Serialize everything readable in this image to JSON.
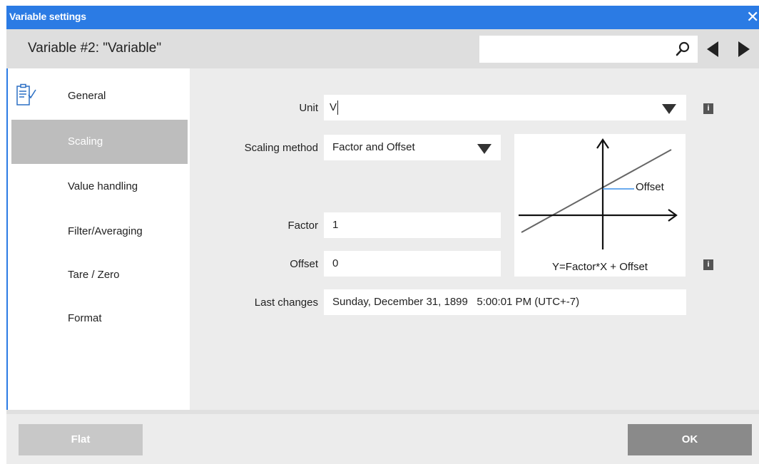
{
  "window": {
    "title": "Variable settings",
    "close": "✕"
  },
  "header": {
    "variable_title": "Variable #2: \"Variable\"",
    "search": {
      "value": "",
      "placeholder": ""
    }
  },
  "sidebar": {
    "items": [
      {
        "label": "General",
        "active": false,
        "icon": "clipboard-check-icon"
      },
      {
        "label": "Scaling",
        "active": true
      },
      {
        "label": "Value handling",
        "active": false
      },
      {
        "label": "Filter/Averaging",
        "active": false
      },
      {
        "label": "Tare / Zero",
        "active": false
      },
      {
        "label": "Format",
        "active": false
      }
    ]
  },
  "form": {
    "unit": {
      "label": "Unit",
      "value": "V"
    },
    "scaling_method": {
      "label": "Scaling method",
      "value": "Factor and Offset"
    },
    "factor": {
      "label": "Factor",
      "value": "1"
    },
    "offset": {
      "label": "Offset",
      "value": "0"
    },
    "last_changes": {
      "label": "Last changes",
      "value": "Sunday, December 31, 1899   5:00:01 PM (UTC+-7)"
    },
    "info": "i"
  },
  "diagram": {
    "offset_label": "Offset",
    "formula": "Y=Factor*X + Offset"
  },
  "footer": {
    "flat_label": "Flat",
    "ok_label": "OK"
  },
  "colors": {
    "accent": "#2b7be4",
    "active_item": "#bdbdbd",
    "ok_button": "#8a8a8a",
    "flat_button": "#c8c8c8"
  }
}
